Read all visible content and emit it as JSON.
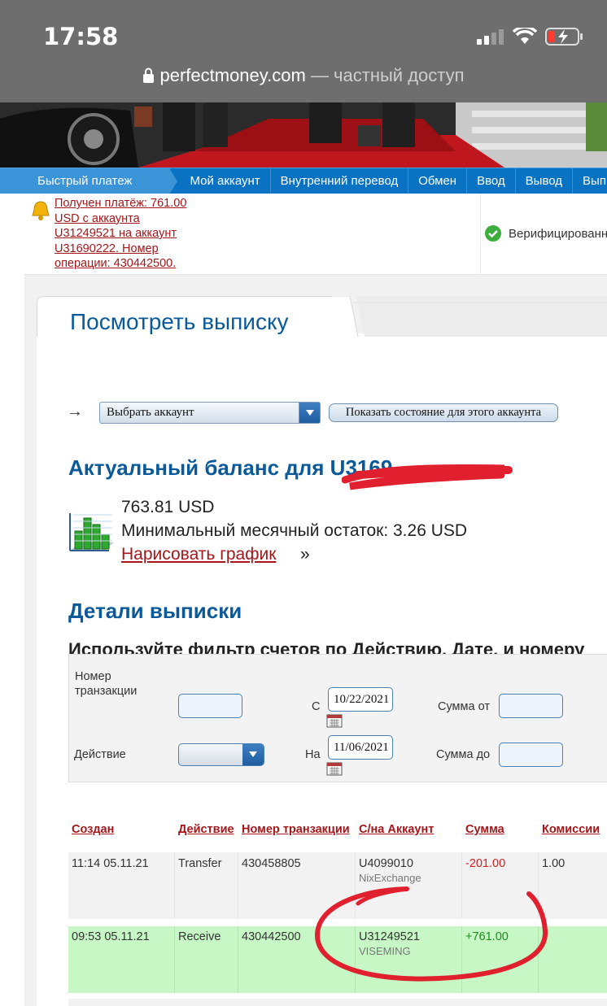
{
  "status_bar": {
    "time": "17:58"
  },
  "address_bar": {
    "domain": "perfectmoney.com",
    "suffix": " — частный доступ"
  },
  "menu": {
    "items": [
      "Быстрый платеж",
      "Мой аккаунт",
      "Внутренний перевод",
      "Обмен",
      "Ввод",
      "Вывод",
      "Выписка"
    ]
  },
  "notice": {
    "message": "Получен платёж: 761.00 USD с аккаунта U31249521 на аккаунт U31690222. Номер операции: 430442500.",
    "verified": "Верифицированный"
  },
  "page": {
    "tab_title": "Посмотреть выписку",
    "arrow": "→",
    "account_select": "Выбрать аккаунт",
    "show_button": "Показать состояние для этого аккаунта",
    "balance_title": "Актуальный баланс для U3169",
    "balance_amount": "763.81 USD",
    "min_balance": "Минимальный месячный остаток: 3.26 USD",
    "chart_link": "Нарисовать график",
    "chart_link_suffix": "»",
    "details_title": "Детали выписки",
    "filter_hint": "Используйте фильтр счетов по Действию, Дате, и номеру"
  },
  "filter": {
    "tx_number_label": "Номер транзакции",
    "action_label": "Действие",
    "from_label": "С",
    "to_label": "На",
    "from_date": "10/22/2021",
    "to_date": "11/06/2021",
    "amount_from_label": "Сумма от",
    "amount_to_label": "Сумма до"
  },
  "table": {
    "headers": [
      "Создан",
      "Действие",
      "Номер транзакции",
      "С/на Аккаунт",
      "Сумма",
      "Комиссии"
    ],
    "rows": [
      {
        "created": "11:14 05.11.21",
        "action": "Transfer",
        "tx": "430458805",
        "account": "U4099010",
        "account_name": "NixExchange",
        "amount": "-201.00",
        "fee": "1.00"
      },
      {
        "created": "09:53 05.11.21",
        "action": "Receive",
        "tx": "430442500",
        "account": "U31249521",
        "account_name": "VISEMING",
        "amount": "+761.00",
        "fee": ""
      }
    ]
  },
  "colors": {
    "menu_blue": "#0a72c2",
    "title_blue": "#0a5a9a",
    "link_red": "#a4161a",
    "highlight_green": "#c6f7c4",
    "marker_red": "#e0202e"
  }
}
